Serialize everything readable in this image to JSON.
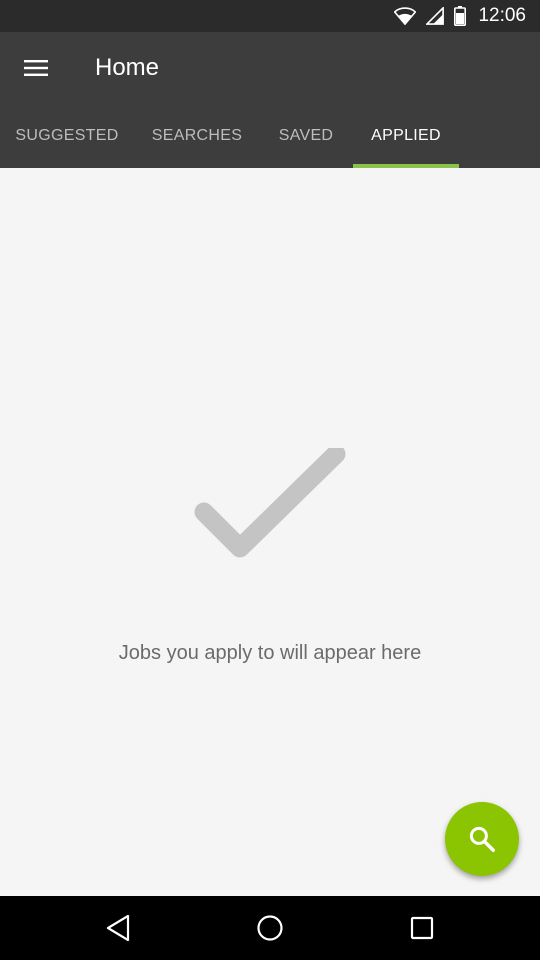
{
  "status_bar": {
    "time": "12:06",
    "icons": [
      "wifi-icon",
      "signal-icon",
      "battery-icon"
    ]
  },
  "app_bar": {
    "title": "Home",
    "menu_icon": "hamburger-menu-icon"
  },
  "tabs": [
    {
      "label": "SUGGESTED",
      "active": false
    },
    {
      "label": "SEARCHES",
      "active": false
    },
    {
      "label": "SAVED",
      "active": false
    },
    {
      "label": "APPLIED",
      "active": true
    }
  ],
  "empty_state": {
    "icon": "checkmark-icon",
    "message": "Jobs you apply to will appear here"
  },
  "fab": {
    "icon": "search-icon"
  },
  "navigation": {
    "back_icon": "back-icon",
    "home_icon": "home-icon",
    "recents_icon": "recents-icon"
  },
  "colors": {
    "app_bar": "#3d3d3d",
    "accent": "#8bc34a",
    "fab": "#8bc400",
    "content_bg": "#f5f5f5"
  }
}
